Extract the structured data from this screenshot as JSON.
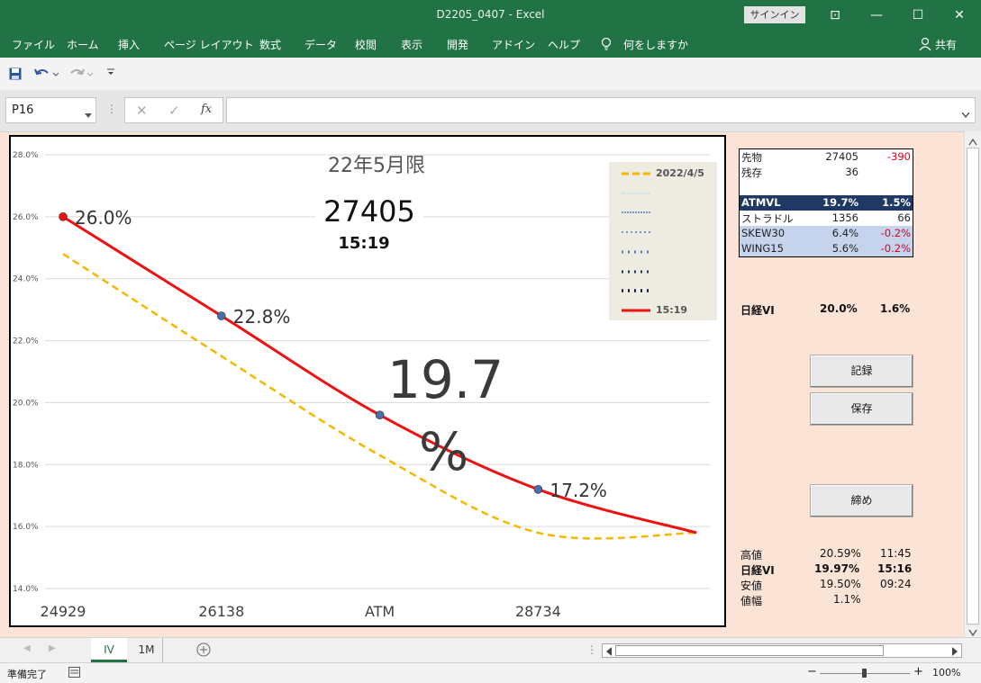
{
  "window": {
    "title": "D2205_0407  -  Excel",
    "signin": "サインイン",
    "controls": [
      "⊡",
      "—",
      "☐",
      "✕"
    ]
  },
  "menu": {
    "items": [
      "ファイル",
      "ホーム",
      "挿入",
      "ページ レイアウト",
      "数式",
      "データ",
      "校閲",
      "表示",
      "開発",
      "アドイン",
      "ヘルプ"
    ],
    "tell_me": "何をしますか",
    "share": "共有"
  },
  "formula_bar": {
    "name_box": "P16",
    "fx": "fx",
    "value": ""
  },
  "chart": {
    "title": "22年5月限",
    "futures_price": "27405",
    "time": "15:19",
    "atm_iv_number": "19.7",
    "atm_iv_unit": "%"
  },
  "chart_data": {
    "type": "line",
    "categories": [
      "24929",
      "26138",
      "ATM",
      "28734"
    ],
    "ylim": [
      14.0,
      28.0
    ],
    "yticks": [
      "28.0%",
      "26.0%",
      "24.0%",
      "22.0%",
      "20.0%",
      "18.0%",
      "16.0%",
      "14.0%"
    ],
    "grid": true,
    "legend_placement": "top-right",
    "legend": [
      "2022/4/5",
      "",
      "",
      "",
      "",
      "",
      "",
      "15:19"
    ],
    "series": [
      {
        "name": "15:19",
        "color": "#ee1111",
        "style": "solid",
        "x": [
          0,
          1,
          2,
          3,
          4
        ],
        "values": [
          26.0,
          22.8,
          19.6,
          17.2,
          15.8
        ],
        "markers": [
          true,
          true,
          true,
          true,
          false
        ],
        "point_labels": [
          "26.0%",
          "22.8%",
          "",
          "17.2%",
          ""
        ]
      },
      {
        "name": "2022/4/5",
        "color": "#f5b800",
        "style": "dashed",
        "x": [
          0,
          1,
          2,
          3,
          4
        ],
        "values": [
          24.8,
          21.5,
          18.3,
          15.8,
          15.8
        ],
        "markers": [
          false,
          false,
          false,
          false,
          false
        ],
        "point_labels": [
          "",
          "",
          "",
          "",
          ""
        ]
      }
    ]
  },
  "info": {
    "rows": [
      {
        "label": "先物",
        "v1": "27405",
        "v2": "-390"
      },
      {
        "label": "残存",
        "v1": "36",
        "v2": ""
      },
      {
        "label": "",
        "v1": "",
        "v2": ""
      },
      {
        "label": "ATMVL",
        "v1": "19.7%",
        "v2": "1.5%"
      },
      {
        "label": "ストラドル",
        "v1": "1356",
        "v2": "66"
      },
      {
        "label": "SKEW30",
        "v1": "6.4%",
        "v2": "-0.2%"
      },
      {
        "label": "WING15",
        "v1": "5.6%",
        "v2": "-0.2%"
      }
    ],
    "colors": {
      "header_bg": "#1f3864",
      "highlight_bg": "#c5d3ec",
      "negative": "#e0001b"
    }
  },
  "nikkei_vi": {
    "label": "日経VI",
    "value": "20.0%",
    "change": "1.6%"
  },
  "buttons": {
    "record": "記録",
    "save": "保存",
    "close": "締め"
  },
  "stats": [
    {
      "label": "高値",
      "value": "20.59%",
      "time": "11:45"
    },
    {
      "label": "日経VI",
      "value": "19.97%",
      "time": "15:16"
    },
    {
      "label": "安値",
      "value": "19.50%",
      "time": "09:24"
    },
    {
      "label": "値幅",
      "value": "1.1%",
      "time": ""
    }
  ],
  "sheet_tabs": [
    "IV",
    "1M"
  ],
  "status": {
    "ready": "準備完了",
    "zoom": "100%"
  }
}
